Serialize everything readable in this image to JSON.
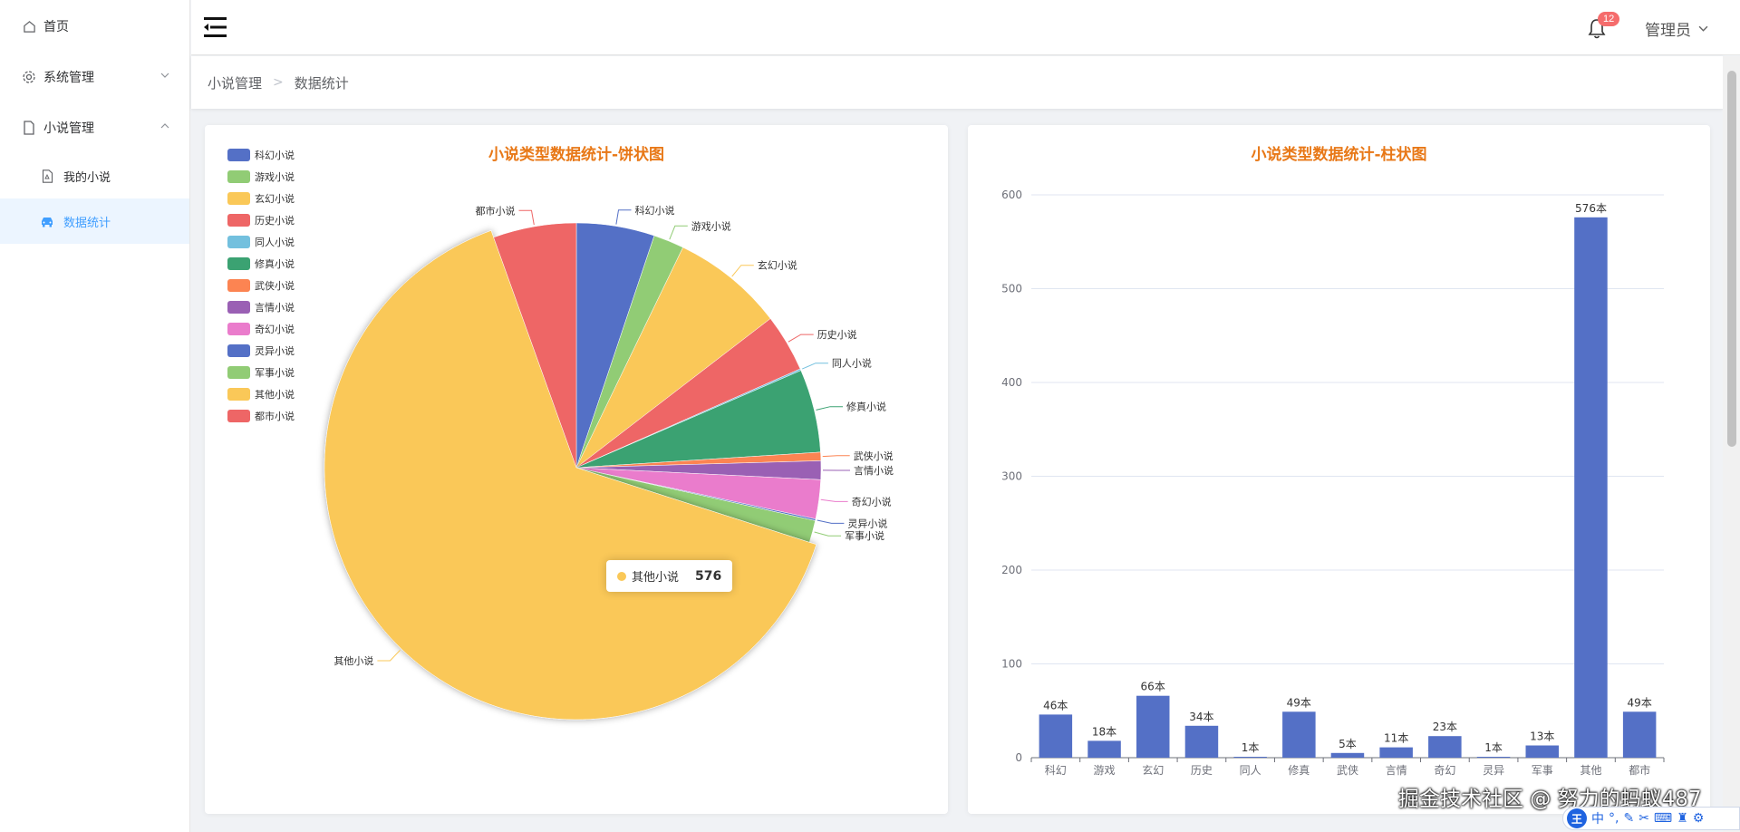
{
  "sidebar": {
    "items": [
      {
        "label": "首页",
        "icon": "home-icon"
      },
      {
        "label": "系统管理",
        "icon": "gear-icon"
      },
      {
        "label": "小说管理",
        "icon": "document-icon"
      }
    ],
    "sub_items": [
      {
        "label": "我的小说",
        "icon": "pdf-file-icon"
      },
      {
        "label": "数据统计",
        "icon": "car-icon",
        "active": true
      }
    ]
  },
  "header": {
    "badge": "12",
    "user": "管理员"
  },
  "breadcrumb": [
    "小说管理",
    "数据统计"
  ],
  "pie_card": {
    "title": "小说类型数据统计-饼状图",
    "tooltip": {
      "label": "其他小说",
      "value": "576"
    }
  },
  "bar_card": {
    "title": "小说类型数据统计-柱状图"
  },
  "watermark": "掘金技术社区 @ 努力的蚂蚁487",
  "ime": {
    "logo": "王",
    "mode": "中"
  },
  "colors": {
    "accent": "#409eff",
    "title": "#e87817",
    "bar": "#5470c6",
    "badge": "#f56c6c"
  },
  "chart_data": [
    {
      "type": "pie",
      "title": "小说类型数据统计-饼状图",
      "legend_position": "top-left",
      "categories": [
        "科幻小说",
        "游戏小说",
        "玄幻小说",
        "历史小说",
        "同人小说",
        "修真小说",
        "武侠小说",
        "言情小说",
        "奇幻小说",
        "灵异小说",
        "军事小说",
        "其他小说",
        "都市小说"
      ],
      "values": [
        46,
        18,
        66,
        34,
        1,
        49,
        5,
        11,
        23,
        1,
        13,
        576,
        49
      ],
      "colors": [
        "#5470c6",
        "#91cc75",
        "#fac858",
        "#ee6666",
        "#73c0de",
        "#3ba272",
        "#fc8452",
        "#9a60b4",
        "#ea7ccc",
        "#5470c6",
        "#91cc75",
        "#fac858",
        "#ee6666"
      ],
      "highlighted": "其他小说"
    },
    {
      "type": "bar",
      "title": "小说类型数据统计-柱状图",
      "categories": [
        "科幻",
        "游戏",
        "玄幻",
        "历史",
        "同人",
        "修真",
        "武侠",
        "言情",
        "奇幻",
        "灵异",
        "军事",
        "其他",
        "都市"
      ],
      "values": [
        46,
        18,
        66,
        34,
        1,
        49,
        5,
        11,
        23,
        1,
        13,
        576,
        49
      ],
      "data_labels": [
        "46本",
        "18本",
        "66本",
        "34本",
        "1本",
        "49本",
        "5本",
        "11本",
        "23本",
        "1本",
        "13本",
        "576本",
        "49本"
      ],
      "ylim": [
        0,
        600
      ],
      "yticks": [
        0,
        100,
        200,
        300,
        400,
        500,
        600
      ],
      "grid": true,
      "color": "#5470c6"
    }
  ]
}
